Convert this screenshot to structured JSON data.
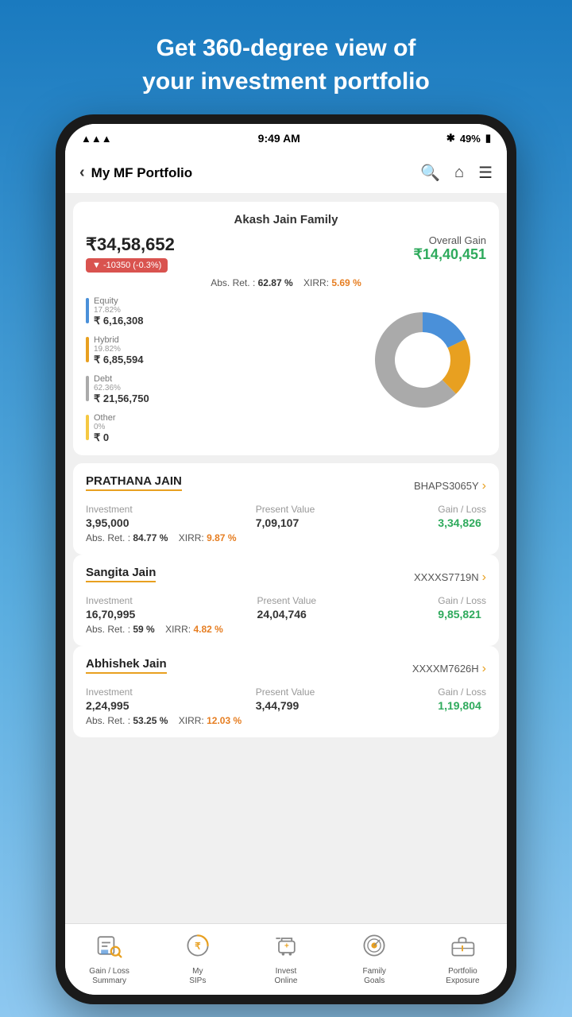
{
  "header": {
    "headline_line1": "Get 360-degree view of",
    "headline_line2": "your investment portfolio"
  },
  "status_bar": {
    "time": "9:49 AM",
    "battery": "49%"
  },
  "nav": {
    "back_label": "My MF Portfolio",
    "search_icon": "search",
    "home_icon": "home",
    "menu_icon": "menu"
  },
  "portfolio": {
    "family_name": "Akash Jain Family",
    "total_value": "₹34,58,652",
    "change_value": "▼ -10350 (-0.3%)",
    "overall_gain_label": "Overall Gain",
    "overall_gain_value": "₹14,40,451",
    "abs_ret_label": "Abs. Ret. :",
    "abs_ret_value": "62.87 %",
    "xirr_label": "XIRR:",
    "xirr_value": "5.69 %",
    "allocations": [
      {
        "label": "Equity",
        "pct": "17.82%",
        "amount": "₹ 6,16,308",
        "color": "#4a90d9"
      },
      {
        "label": "Hybrid",
        "pct": "19.82%",
        "amount": "₹ 6,85,594",
        "color": "#e8a020"
      },
      {
        "label": "Debt",
        "pct": "62.36%",
        "amount": "₹ 21,56,750",
        "color": "#aaa"
      },
      {
        "label": "Other",
        "pct": "0%",
        "amount": "₹ 0",
        "color": "#f5c842"
      }
    ],
    "donut": {
      "segments": [
        {
          "label": "Equity",
          "pct": 17.82,
          "color": "#4a90d9"
        },
        {
          "label": "Hybrid",
          "pct": 19.82,
          "color": "#e8a020"
        },
        {
          "label": "Debt",
          "pct": 62.36,
          "color": "#aaa"
        }
      ]
    }
  },
  "members": [
    {
      "name": "PRATHANA JAIN",
      "pan": "BHAPS3065Y",
      "investment_label": "Investment",
      "investment_value": "3,95,000",
      "present_value_label": "Present Value",
      "present_value": "7,09,107",
      "gain_loss_label": "Gain / Loss",
      "gain_loss": "3,34,826",
      "abs_ret_label": "Abs. Ret. :",
      "abs_ret_value": "84.77 %",
      "xirr_label": "XIRR:",
      "xirr_value": "9.87 %"
    },
    {
      "name": "Sangita Jain",
      "pan": "XXXXS7719N",
      "investment_label": "Investment",
      "investment_value": "16,70,995",
      "present_value_label": "Present Value",
      "present_value": "24,04,746",
      "gain_loss_label": "Gain / Loss",
      "gain_loss": "9,85,821",
      "abs_ret_label": "Abs. Ret. :",
      "abs_ret_value": "59 %",
      "xirr_label": "XIRR:",
      "xirr_value": "4.82 %"
    },
    {
      "name": "Abhishek Jain",
      "pan": "XXXXM7626H",
      "investment_label": "Investment",
      "investment_value": "2,24,995",
      "present_value_label": "Present Value",
      "present_value": "3,44,799",
      "gain_loss_label": "Gain / Loss",
      "gain_loss": "1,19,804",
      "abs_ret_label": "Abs. Ret. :",
      "abs_ret_value": "53.25 %",
      "xirr_label": "XIRR:",
      "xirr_value": "12.03 %"
    }
  ],
  "bottom_nav": [
    {
      "id": "gain-loss-summary",
      "label": "Gain / Loss\nSummary",
      "icon": "chart-search"
    },
    {
      "id": "my-sips",
      "label": "My\nSIPs",
      "icon": "sip"
    },
    {
      "id": "invest-online",
      "label": "Invest\nOnline",
      "icon": "cart"
    },
    {
      "id": "family-goals",
      "label": "Family\nGoals",
      "icon": "target"
    },
    {
      "id": "portfolio-exposure",
      "label": "Portfolio\nExposure",
      "icon": "briefcase"
    }
  ]
}
